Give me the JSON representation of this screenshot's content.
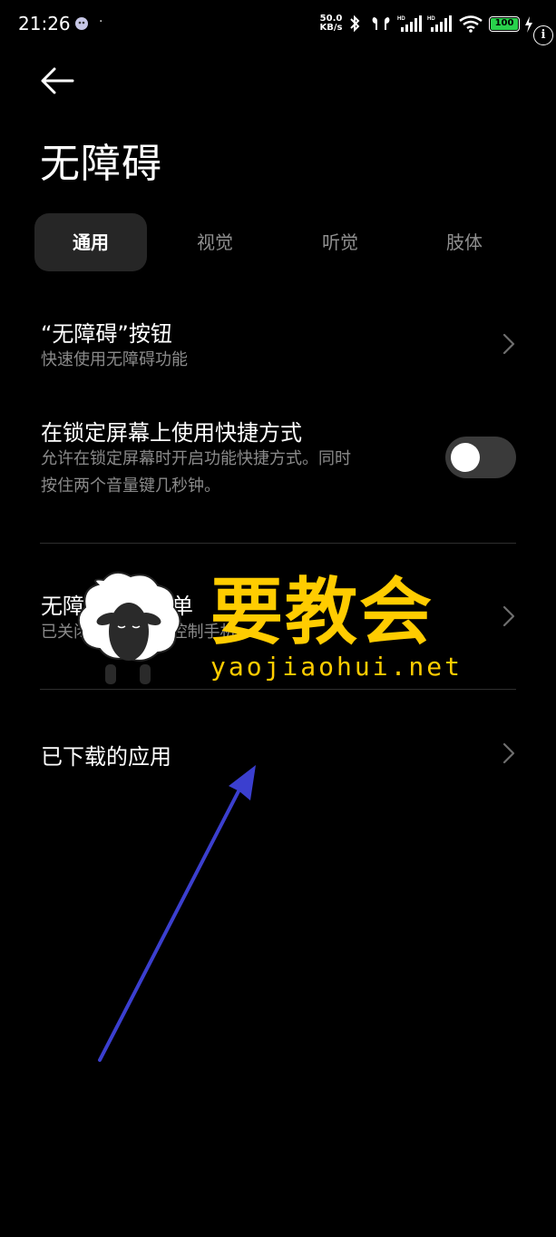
{
  "status_bar": {
    "time": "21:26",
    "dot": "·",
    "net_speed_value": "50.0",
    "net_speed_unit": "KB/s",
    "battery": "100",
    "icons": [
      "bluetooth-icon",
      "earbuds-icon",
      "signal-hd-icon",
      "signal-hd-icon",
      "wifi-icon",
      "charging-icon",
      "info-icon"
    ],
    "battery_color": "#29d14c"
  },
  "header": {
    "title": "无障碍"
  },
  "tabs": [
    {
      "label": "通用",
      "active": true
    },
    {
      "label": "视觉",
      "active": false
    },
    {
      "label": "听觉",
      "active": false
    },
    {
      "label": "肢体",
      "active": false
    }
  ],
  "settings": {
    "button": {
      "title": "“无障碍”按钮",
      "subtitle": "快速使用无障碍功能"
    },
    "lock_shortcut": {
      "title": "在锁定屏幕上使用快捷方式",
      "subtitle_line1": "允许在锁定屏幕时开启功能快捷方式。同时",
      "subtitle_line2": "按住两个音量键几秒钟。",
      "enabled": false
    },
    "menu": {
      "title": "无障碍功能菜单",
      "subtitle": "已关闭 / 大型菜单控制手机"
    },
    "downloaded": {
      "title": "已下载的应用"
    }
  },
  "watermark": {
    "text": "要教会",
    "url": "yaojiaohui.net",
    "color": "#ffcc00"
  },
  "annotation": {
    "color": "#3b3fcf"
  }
}
